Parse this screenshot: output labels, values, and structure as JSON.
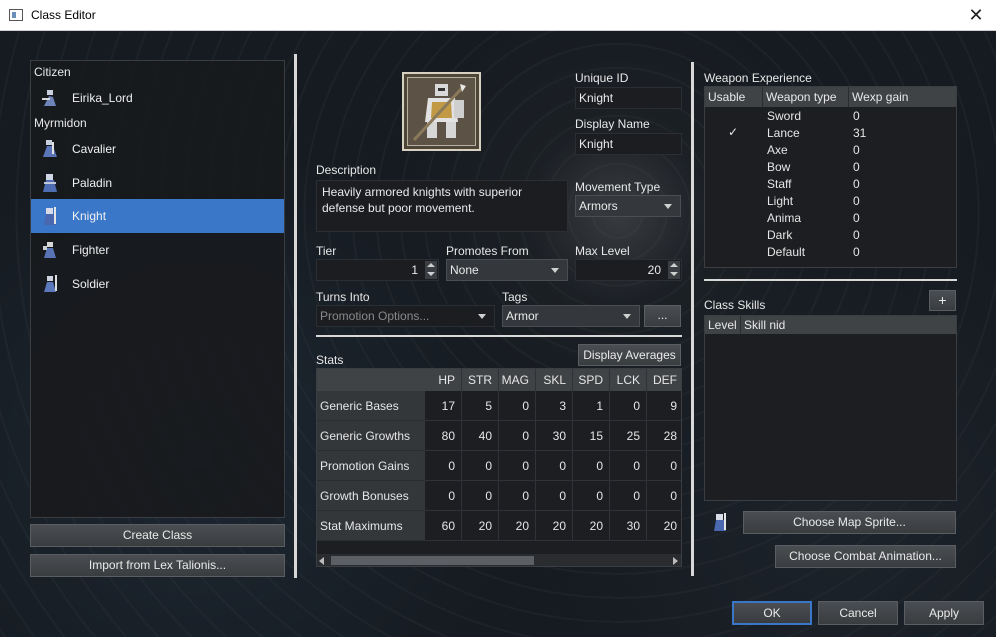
{
  "window": {
    "title": "Class Editor"
  },
  "class_list": {
    "items": [
      {
        "kind": "header",
        "label": "Citizen"
      },
      {
        "kind": "item",
        "label": "Eirika_Lord"
      },
      {
        "kind": "header",
        "label": "Myrmidon"
      },
      {
        "kind": "item",
        "label": "Cavalier"
      },
      {
        "kind": "item",
        "label": "Paladin"
      },
      {
        "kind": "item",
        "label": "Knight",
        "selected": true
      },
      {
        "kind": "item",
        "label": "Fighter"
      },
      {
        "kind": "item",
        "label": "Soldier"
      }
    ],
    "create_button": "Create Class",
    "import_button": "Import from Lex Talionis..."
  },
  "form": {
    "unique_id_label": "Unique ID",
    "unique_id_value": "Knight",
    "display_name_label": "Display Name",
    "display_name_value": "Knight",
    "description_label": "Description",
    "description_value": "Heavily armored knights with superior defense but poor movement.",
    "movement_type_label": "Movement Type",
    "movement_type_value": "Armors",
    "tier_label": "Tier",
    "tier_value": "1",
    "promotes_from_label": "Promotes From",
    "promotes_from_value": "None",
    "max_level_label": "Max Level",
    "max_level_value": "20",
    "turns_into_label": "Turns Into",
    "turns_into_placeholder": "Promotion Options...",
    "tags_label": "Tags",
    "tags_value": "Armor",
    "tags_more_button": "..."
  },
  "stats": {
    "label": "Stats",
    "display_averages_button": "Display Averages",
    "columns": [
      "HP",
      "STR",
      "MAG",
      "SKL",
      "SPD",
      "LCK",
      "DEF"
    ],
    "rows": [
      {
        "label": "Generic Bases",
        "values": [
          "17",
          "5",
          "0",
          "3",
          "1",
          "0",
          "9"
        ]
      },
      {
        "label": "Generic Growths",
        "values": [
          "80",
          "40",
          "0",
          "30",
          "15",
          "25",
          "28"
        ]
      },
      {
        "label": "Promotion Gains",
        "values": [
          "0",
          "0",
          "0",
          "0",
          "0",
          "0",
          "0"
        ]
      },
      {
        "label": "Growth Bonuses",
        "values": [
          "0",
          "0",
          "0",
          "0",
          "0",
          "0",
          "0"
        ]
      },
      {
        "label": "Stat Maximums",
        "values": [
          "60",
          "20",
          "20",
          "20",
          "20",
          "30",
          "20"
        ]
      }
    ]
  },
  "weapon_experience": {
    "label": "Weapon Experience",
    "columns": [
      "Usable",
      "Weapon type",
      "Wexp gain"
    ],
    "rows": [
      {
        "usable": false,
        "type": "Sword",
        "gain": "0"
      },
      {
        "usable": true,
        "type": "Lance",
        "gain": "31"
      },
      {
        "usable": false,
        "type": "Axe",
        "gain": "0"
      },
      {
        "usable": false,
        "type": "Bow",
        "gain": "0"
      },
      {
        "usable": false,
        "type": "Staff",
        "gain": "0"
      },
      {
        "usable": false,
        "type": "Light",
        "gain": "0"
      },
      {
        "usable": false,
        "type": "Anima",
        "gain": "0"
      },
      {
        "usable": false,
        "type": "Dark",
        "gain": "0"
      },
      {
        "usable": false,
        "type": "Default",
        "gain": "0"
      }
    ]
  },
  "class_skills": {
    "label": "Class Skills",
    "add_button": "+",
    "columns": [
      "Level",
      "Skill nid"
    ]
  },
  "sprites": {
    "map_sprite_button": "Choose Map Sprite...",
    "combat_anim_button": "Choose Combat Animation..."
  },
  "dialog_buttons": {
    "ok": "OK",
    "cancel": "Cancel",
    "apply": "Apply"
  },
  "colors": {
    "selection": "#3a77c9",
    "panel": "#1c1e21",
    "header": "#404346"
  }
}
